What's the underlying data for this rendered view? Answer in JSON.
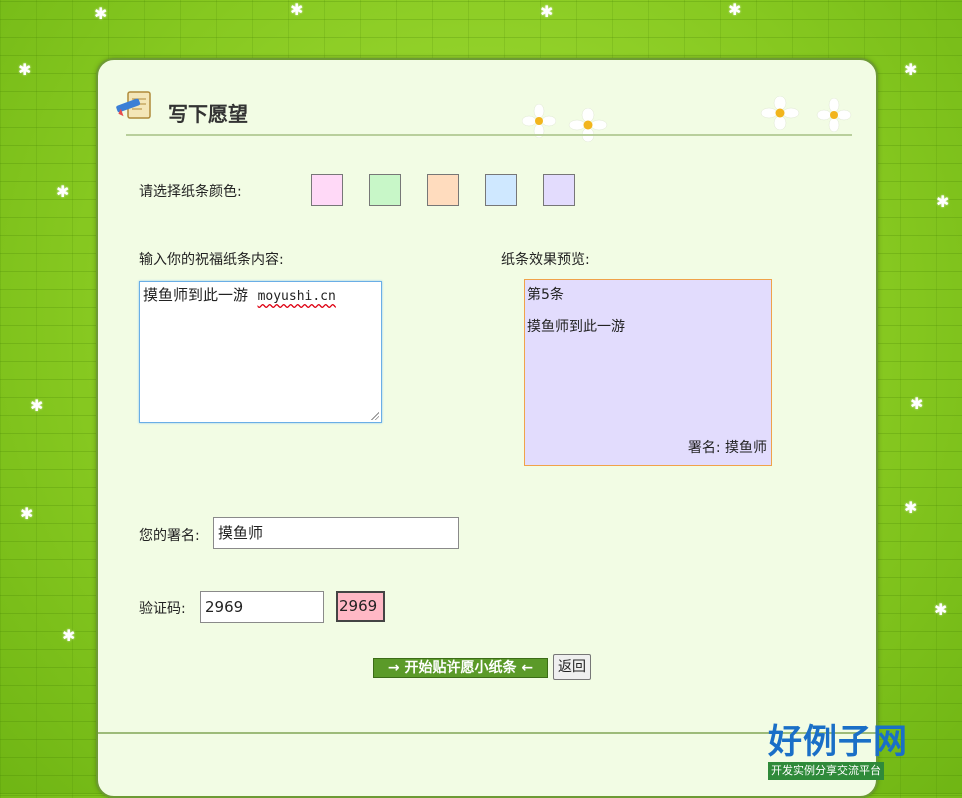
{
  "header": {
    "title": "写下愿望"
  },
  "color_picker": {
    "label": "请选择纸条颜色:",
    "swatches": [
      "#ffd9f7",
      "#c8f7c8",
      "#ffdcbe",
      "#cfe8ff",
      "#e3dcfd"
    ]
  },
  "content": {
    "label": "输入你的祝福纸条内容:",
    "text_cn": "摸鱼师到此一游",
    "text_link": "moyushi.cn"
  },
  "preview": {
    "label": "纸条效果预览:",
    "number": "第5条",
    "text": "摸鱼师到此一游",
    "signature": "署名: 摸鱼师",
    "background": "#e2dcfd",
    "border": "#f0a24a"
  },
  "signature": {
    "label": "您的署名:",
    "value": "摸鱼师"
  },
  "captcha": {
    "label": "验证码:",
    "value": "2969",
    "code": "2969"
  },
  "actions": {
    "submit_label": "→ 开始贴许愿小纸条 ←",
    "back_label": "返回"
  },
  "watermark": {
    "brand": "好例子网",
    "tagline": "开发实例分享交流平台"
  }
}
